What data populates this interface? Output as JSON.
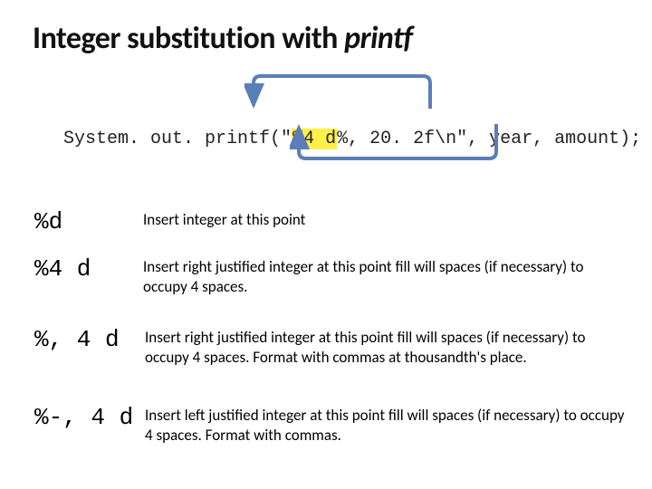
{
  "title_prefix": "Integer substitution with ",
  "title_italic": "printf",
  "code": {
    "pre": "System. out. printf(\"",
    "hl": "%4 d",
    "post": "%, 20. 2f\\n\", year, amount);"
  },
  "rows": [
    {
      "spec": "%d",
      "desc": "Insert integer at this point"
    },
    {
      "spec": "%4 d",
      "desc": "Insert right justified integer at this point fill will spaces (if necessary) to occupy 4 spaces."
    },
    {
      "spec": "%, 4 d",
      "desc": "Insert right justified integer at this point fill will spaces (if necessary) to occupy 4 spaces.   Format with commas at thousandth's place."
    },
    {
      "spec": "%-, 4 d",
      "desc": "Insert left justified integer at this point fill will spaces (if necessary) to occupy 4 spaces.  Format with commas."
    }
  ]
}
